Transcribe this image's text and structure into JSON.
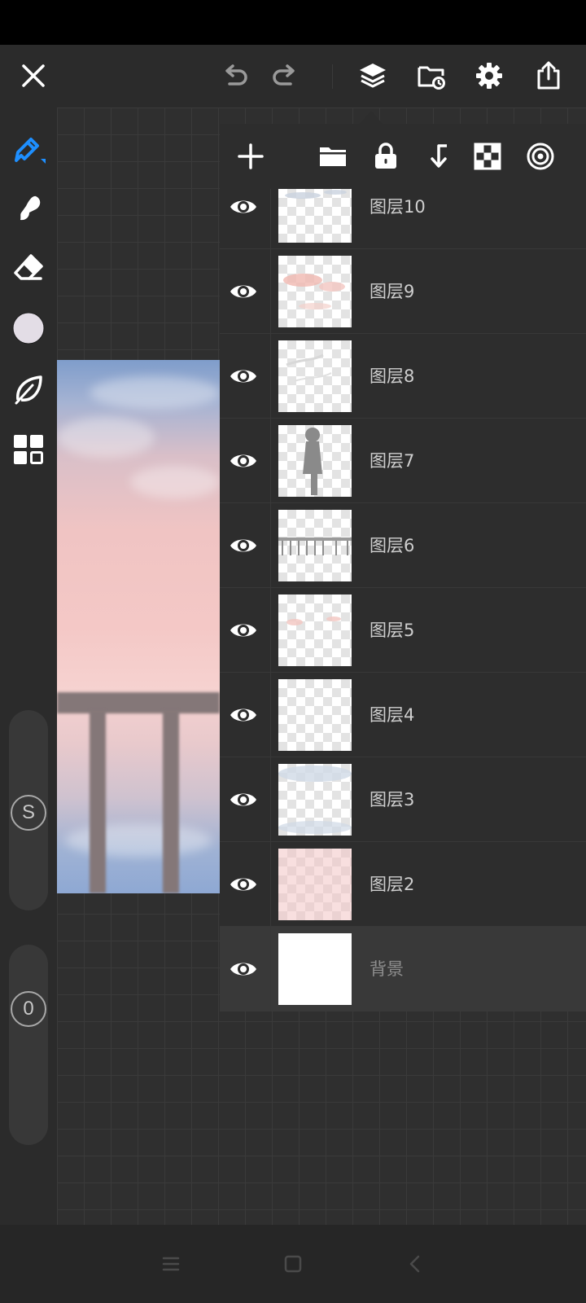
{
  "app": {
    "accent_color": "#1e8fff",
    "icon_color": "#ffffff"
  },
  "top_toolbar": {
    "icons": [
      "close-icon",
      "undo-icon",
      "redo-icon",
      "layers-icon",
      "gallery-icon",
      "settings-icon",
      "share-icon"
    ]
  },
  "left_toolbar": {
    "tools": [
      "pen-tool-icon",
      "smudge-tool-icon",
      "eraser-tool-icon",
      "color-swatch",
      "leaf-icon",
      "grid-menu-icon"
    ],
    "color_swatch": "#e3dde6",
    "size_slider": {
      "label": "S"
    },
    "opacity_slider": {
      "label": "0"
    }
  },
  "layers_panel": {
    "toolbar_icons": [
      "add-layer-icon",
      "folder-icon",
      "lock-icon",
      "merge-down-icon",
      "transparency-icon",
      "target-icon"
    ],
    "layers": [
      {
        "name": "图层10",
        "visible": true,
        "thumb": "clouds-gray"
      },
      {
        "name": "图层9",
        "visible": true,
        "thumb": "clouds-pink"
      },
      {
        "name": "图层8",
        "visible": true,
        "thumb": "faint-strokes"
      },
      {
        "name": "图层7",
        "visible": true,
        "thumb": "figure"
      },
      {
        "name": "图层6",
        "visible": true,
        "thumb": "railing"
      },
      {
        "name": "图层5",
        "visible": true,
        "thumb": "pink-dabs"
      },
      {
        "name": "图层4",
        "visible": true,
        "thumb": "empty"
      },
      {
        "name": "图层3",
        "visible": true,
        "thumb": "blue-haze"
      },
      {
        "name": "图层2",
        "visible": true,
        "thumb": "pink-fill"
      },
      {
        "name": "背景",
        "visible": true,
        "thumb": "white",
        "selected": true
      }
    ]
  },
  "nav_bar": {
    "buttons": [
      "menu-nav-icon",
      "home-nav-icon",
      "back-nav-icon"
    ]
  }
}
